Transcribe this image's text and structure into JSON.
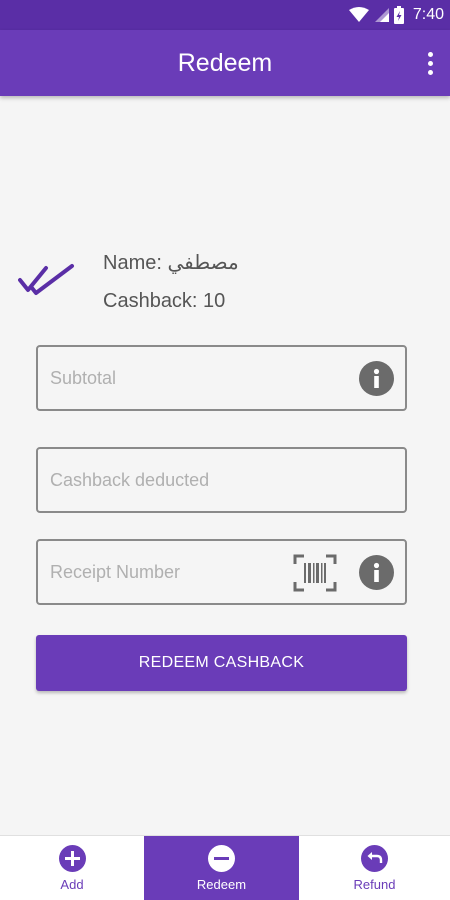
{
  "status_bar": {
    "time": "7:40"
  },
  "app_bar": {
    "title": "Redeem"
  },
  "customer": {
    "name_line": "Name: مصطفي",
    "cashback_line": "Cashback: 10"
  },
  "form": {
    "subtotal": {
      "placeholder": "Subtotal",
      "value": ""
    },
    "cashback_deducted": {
      "placeholder": "Cashback deducted",
      "value": ""
    },
    "receipt_number": {
      "placeholder": "Receipt Number",
      "value": ""
    },
    "submit_label": "REDEEM CASHBACK"
  },
  "bottom_nav": {
    "items": [
      {
        "label": "Add",
        "icon": "plus-circle-icon",
        "active": false
      },
      {
        "label": "Redeem",
        "icon": "minus-circle-icon",
        "active": true
      },
      {
        "label": "Refund",
        "icon": "undo-circle-icon",
        "active": false
      }
    ]
  },
  "colors": {
    "primary": "#6a3cb8",
    "status_bar": "#5a2ea6",
    "background": "#f5f5f5",
    "field_border": "#8a8a8a",
    "icon_gray": "#6b6b6b"
  }
}
